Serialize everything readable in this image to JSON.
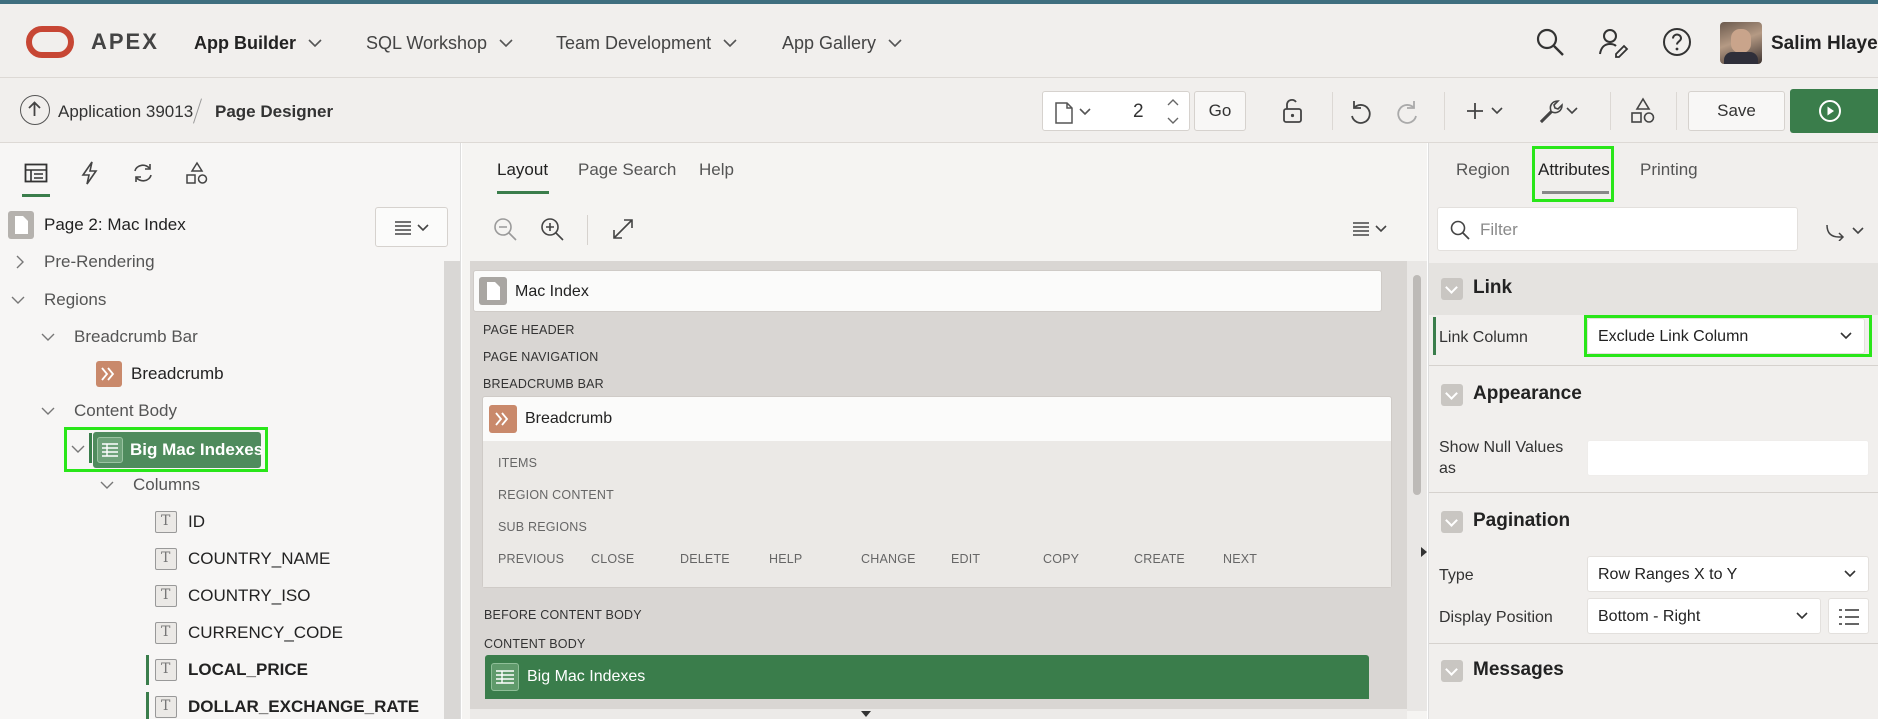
{
  "app": {
    "brand": "APEX",
    "nav": [
      {
        "label": "App Builder",
        "active": true
      },
      {
        "label": "SQL Workshop",
        "active": false
      },
      {
        "label": "Team Development",
        "active": false
      },
      {
        "label": "App Gallery",
        "active": false
      }
    ],
    "user_name": "Salim Hlayel"
  },
  "toolbar": {
    "breadcrumb_app": "Application 39013",
    "breadcrumb_page": "Page Designer",
    "page_number": "2",
    "go_label": "Go",
    "save_label": "Save"
  },
  "left_panel": {
    "page_title": "Page 2: Mac Index",
    "tree": {
      "pre_rendering": "Pre-Rendering",
      "regions": "Regions",
      "breadcrumb_bar": "Breadcrumb Bar",
      "breadcrumb": "Breadcrumb",
      "content_body": "Content Body",
      "selected_region": "Big Mac Indexes",
      "columns": "Columns",
      "column_items": [
        "ID",
        "COUNTRY_NAME",
        "COUNTRY_ISO",
        "CURRENCY_CODE",
        "LOCAL_PRICE",
        "DOLLAR_EXCHANGE_RATE"
      ]
    }
  },
  "center_panel": {
    "tabs": [
      "Layout",
      "Page Search",
      "Help"
    ],
    "page_card_title": "Mac Index",
    "positions": {
      "page_header": "PAGE HEADER",
      "page_navigation": "PAGE NAVIGATION",
      "breadcrumb_bar": "BREADCRUMB BAR",
      "before_content_body": "BEFORE CONTENT BODY",
      "content_body": "CONTENT BODY"
    },
    "breadcrumb_card": {
      "title": "Breadcrumb",
      "items": "ITEMS",
      "region_content": "REGION CONTENT",
      "sub_regions": "SUB REGIONS",
      "buttons": [
        "PREVIOUS",
        "CLOSE",
        "DELETE",
        "HELP",
        "CHANGE",
        "EDIT",
        "COPY",
        "CREATE",
        "NEXT"
      ]
    },
    "region_card_title": "Big Mac Indexes"
  },
  "right_panel": {
    "tabs": [
      "Region",
      "Attributes",
      "Printing"
    ],
    "filter_placeholder": "Filter",
    "sections": {
      "link": "Link",
      "appearance": "Appearance",
      "pagination": "Pagination",
      "messages": "Messages"
    },
    "props": {
      "link_column_label": "Link Column",
      "link_column_value": "Exclude Link Column",
      "show_null_label": "Show Null Values as",
      "show_null_value": "",
      "type_label": "Type",
      "type_value": "Row Ranges X to Y",
      "display_position_label": "Display Position",
      "display_position_value": "Bottom - Right"
    }
  },
  "colors": {
    "brand_red": "#c74634",
    "accent_green": "#3a7d4b",
    "highlight_green": "#29e619"
  }
}
